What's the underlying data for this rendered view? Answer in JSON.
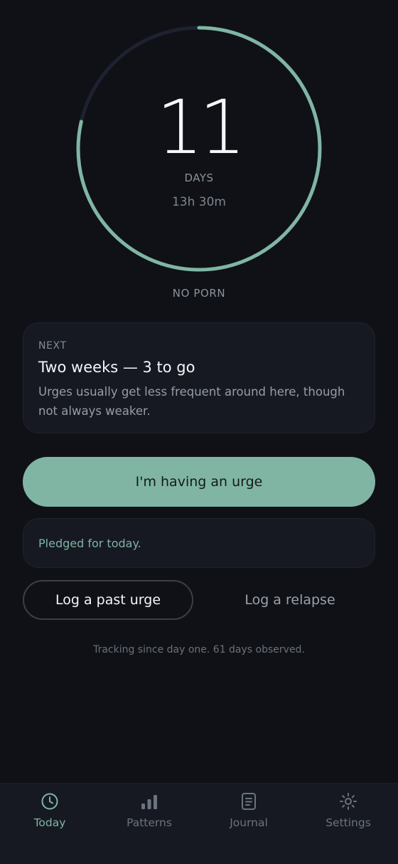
{
  "counter": {
    "days": "11",
    "unit": "DAYS",
    "elapsed": "13h 30m",
    "progress": 0.7857,
    "goal_label": "NO PORN"
  },
  "next_milestone": {
    "kicker": "NEXT",
    "title": "Two weeks — 3 to go",
    "body": "Urges usually get less frequent around here, though not always weaker."
  },
  "actions": {
    "urge_label": "I'm having an urge",
    "past_urge_label": "Log a past urge",
    "relapse_label": "Log a relapse"
  },
  "pledge": {
    "text": "Pledged for today."
  },
  "footer_note": "Tracking since day one. 61 days observed.",
  "tabs": [
    {
      "label": "Today",
      "icon": "clock-icon",
      "active": true
    },
    {
      "label": "Patterns",
      "icon": "bar-chart-icon",
      "active": false
    },
    {
      "label": "Journal",
      "icon": "document-icon",
      "active": false
    },
    {
      "label": "Settings",
      "icon": "sun-gear-icon",
      "active": false
    }
  ],
  "colors": {
    "accent": "#80b5a4",
    "background": "#0f1116",
    "card": "#161922",
    "track": "#1e2230"
  }
}
